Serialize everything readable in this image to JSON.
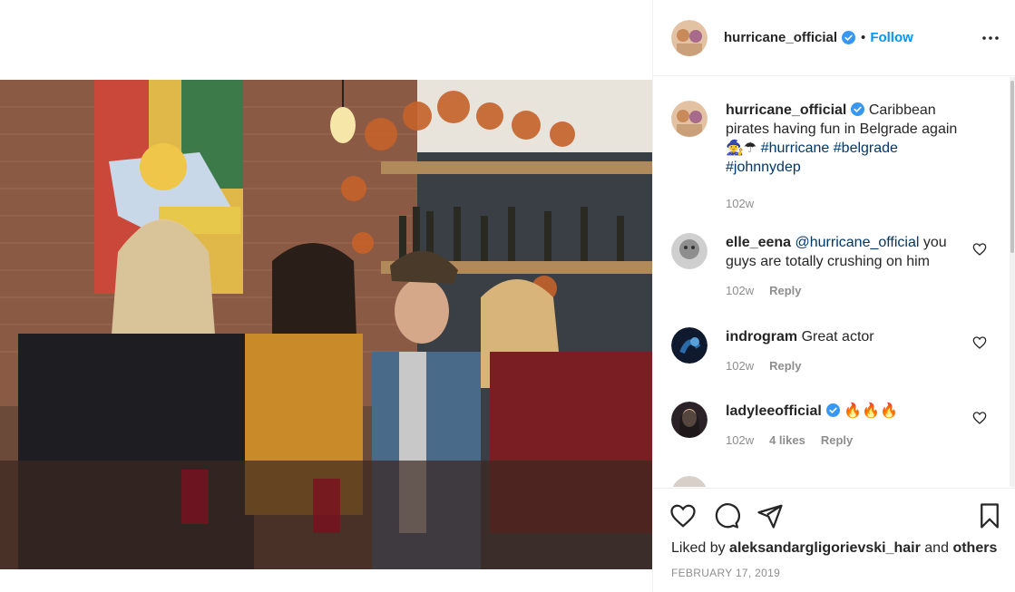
{
  "post": {
    "username": "hurricane_official",
    "follow_label": "Follow",
    "dot": "•",
    "caption": {
      "text": "Caribbean pirates having fun in Belgrade again",
      "emoji": "🧙‍♀️☂",
      "hashtags": [
        "#hurricane",
        "#belgrade",
        "#johnnydep"
      ],
      "time": "102w"
    },
    "comments": [
      {
        "username": "elle_eena",
        "mention": "@hurricane_official",
        "text": "you guys are totally crushing on him",
        "time": "102w",
        "likes": "",
        "reply_label": "Reply"
      },
      {
        "username": "indrogram",
        "mention": "",
        "text": "Great actor",
        "time": "102w",
        "likes": "",
        "reply_label": "Reply"
      },
      {
        "username": "ladyleeofficial",
        "mention": "",
        "text": "🔥🔥🔥",
        "time": "102w",
        "likes": "4 likes",
        "reply_label": "Reply"
      }
    ],
    "liked_by_prefix": "Liked by",
    "liked_by_user": "aleksandargligorievski_hair",
    "liked_by_and": "and",
    "liked_by_others": "others",
    "date": "FEBRUARY 17, 2019"
  },
  "colors": {
    "accent": "#0095f6",
    "hashtag": "#00376b",
    "verified": "#3897f0",
    "secondary_text": "#8e8e8e"
  },
  "icons": [
    "verified-badge-icon",
    "more-options-icon",
    "heart-icon",
    "comment-icon",
    "share-icon",
    "bookmark-icon"
  ]
}
